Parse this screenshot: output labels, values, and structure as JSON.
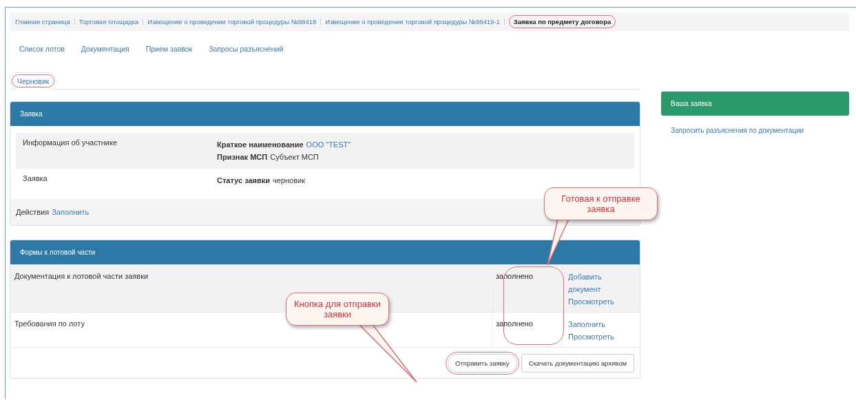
{
  "breadcrumbs": [
    {
      "label": "Главная страница",
      "selected": false,
      "circled": false
    },
    {
      "label": "Торговая площадка",
      "selected": false,
      "circled": false
    },
    {
      "label": "Извещение о проведении торговой процедуры №98419",
      "selected": false,
      "circled": false
    },
    {
      "label": "Извещение о проведении торговой процедуры №98419-1",
      "selected": false,
      "circled": false
    },
    {
      "label": "Заявка по предмету договора",
      "selected": true,
      "circled": true
    }
  ],
  "nav": [
    "Список лотов",
    "Документация",
    "Прием заявок",
    "Запросы разъяснений"
  ],
  "tabs": [
    {
      "label": "Черновик",
      "selected": true,
      "circled": true
    }
  ],
  "application_panel": {
    "title": "Заявка",
    "rows": [
      {
        "label": "Информация об участнике",
        "fields": [
          {
            "name": "Краткое наименование",
            "value": "ООО \"TEST\"",
            "kind": "link"
          },
          {
            "name": "Признак МСП",
            "value": "Субъект МСП",
            "kind": "text"
          }
        ]
      },
      {
        "label": "Заявка",
        "fields": [
          {
            "name": "Статус заявки",
            "value": "черновик",
            "kind": "text"
          }
        ]
      }
    ],
    "actions_label": "Действия",
    "actions": [
      "Заполнить"
    ]
  },
  "forms_panel": {
    "title": "Формы к лотовой части",
    "status_circled": true,
    "rows": [
      {
        "name": "Документация к лотовой части заявки",
        "status": "заполнено",
        "links": [
          "Добавить документ",
          "Просмотреть"
        ]
      },
      {
        "name": "Требования по лоту",
        "status": "заполнено",
        "links": [
          "Заполнить",
          "Просмотреть"
        ]
      }
    ],
    "buttons": [
      {
        "label": "Отправить заявку",
        "circled": true
      },
      {
        "label": "Скачать документацию архивом",
        "circled": false
      }
    ]
  },
  "sidebar": {
    "title": "Ваша заявка",
    "links": [
      "Запросить разъяснения по документации"
    ]
  },
  "callouts": [
    {
      "text": "Готовая к отправке заявка"
    },
    {
      "text": "Кнопка для отправки заявки"
    }
  ]
}
